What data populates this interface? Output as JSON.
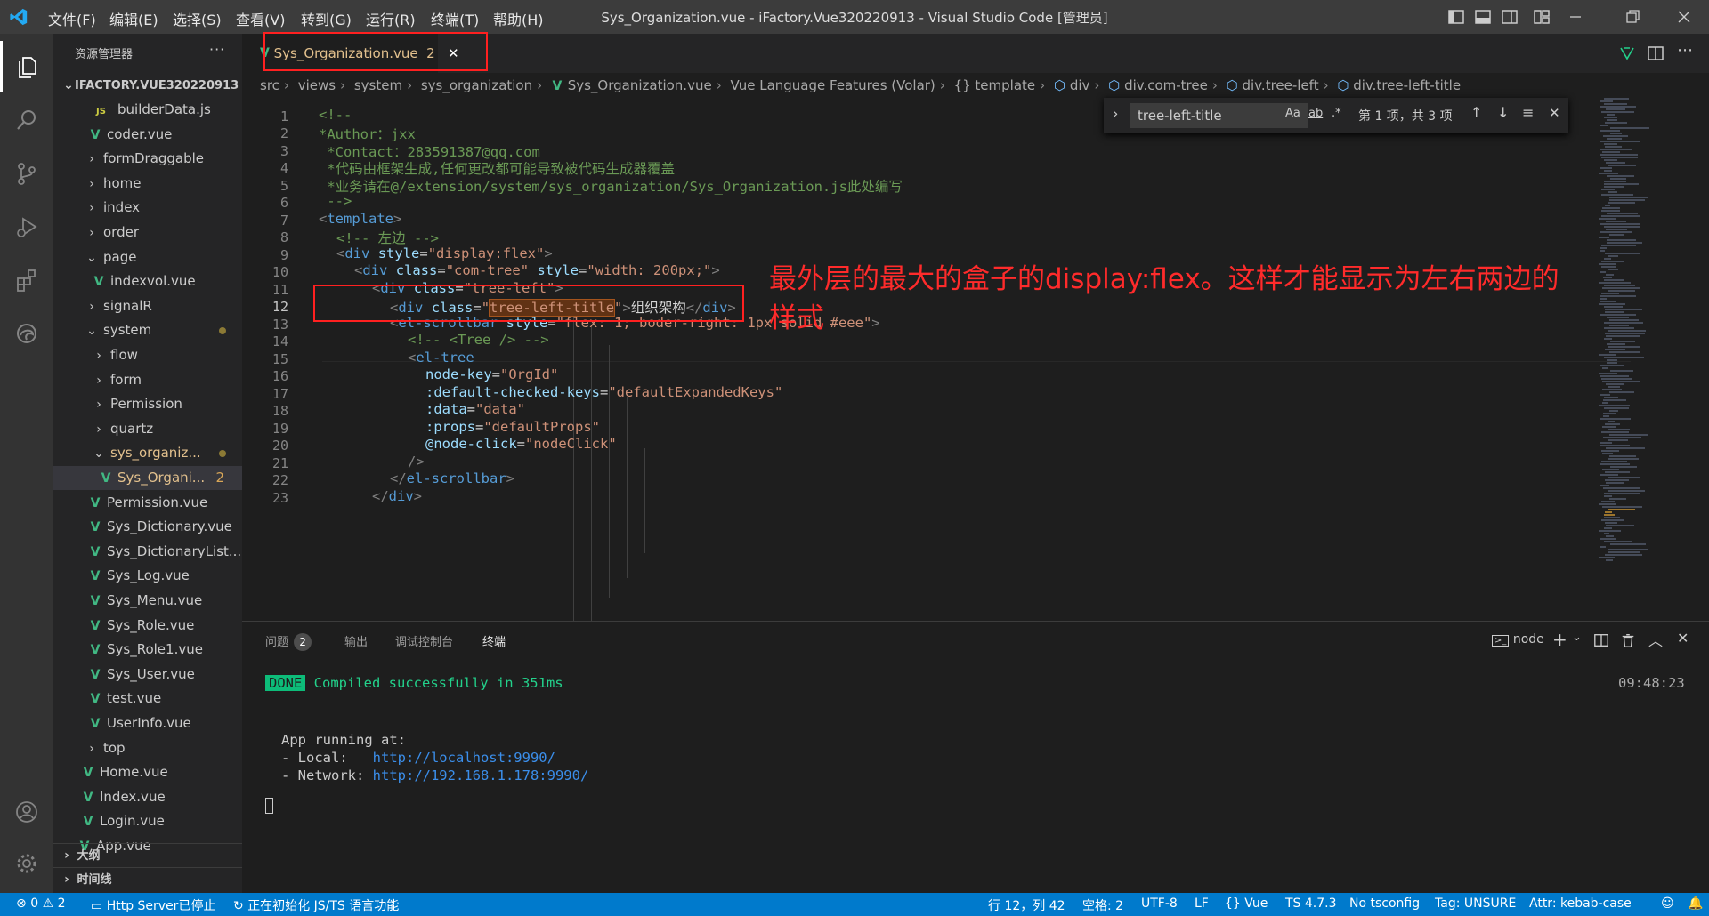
{
  "window": {
    "title": "Sys_Organization.vue - iFactory.Vue320220913 - Visual Studio Code [管理员]",
    "menu": [
      "文件(F)",
      "编辑(E)",
      "选择(S)",
      "查看(V)",
      "转到(G)",
      "运行(R)",
      "终端(T)",
      "帮助(H)"
    ]
  },
  "sidebar": {
    "header": "资源管理器",
    "more": "···",
    "root": "IFACTORY.VUE320220913",
    "rows": [
      {
        "label": "builderData.js",
        "type": "js"
      },
      {
        "label": "coder.vue",
        "type": "vue"
      },
      {
        "label": "formDraggable",
        "type": "folder"
      },
      {
        "label": "home",
        "type": "folder"
      },
      {
        "label": "index",
        "type": "folder"
      },
      {
        "label": "order",
        "type": "folder"
      },
      {
        "label": "page",
        "type": "folder-open"
      },
      {
        "label": "indexvol.vue",
        "type": "vue"
      },
      {
        "label": "signalR",
        "type": "folder"
      },
      {
        "label": "system",
        "type": "folder-open"
      },
      {
        "label": "flow",
        "type": "folder"
      },
      {
        "label": "form",
        "type": "folder"
      },
      {
        "label": "Permission",
        "type": "folder"
      },
      {
        "label": "quartz",
        "type": "folder"
      },
      {
        "label": "sys_organiz...",
        "type": "folder-open"
      },
      {
        "label": "Sys_Organi...",
        "type": "vue",
        "badge": "2"
      },
      {
        "label": "Permission.vue",
        "type": "vue"
      },
      {
        "label": "Sys_Dictionary.vue",
        "type": "vue"
      },
      {
        "label": "Sys_DictionaryList...",
        "type": "vue"
      },
      {
        "label": "Sys_Log.vue",
        "type": "vue"
      },
      {
        "label": "Sys_Menu.vue",
        "type": "vue"
      },
      {
        "label": "Sys_Role.vue",
        "type": "vue"
      },
      {
        "label": "Sys_Role1.vue",
        "type": "vue"
      },
      {
        "label": "Sys_User.vue",
        "type": "vue"
      },
      {
        "label": "test.vue",
        "type": "vue"
      },
      {
        "label": "UserInfo.vue",
        "type": "vue"
      },
      {
        "label": "top",
        "type": "folder"
      },
      {
        "label": "Home.vue",
        "type": "vue"
      },
      {
        "label": "Index.vue",
        "type": "vue"
      },
      {
        "label": "Login.vue",
        "type": "vue"
      },
      {
        "label": "App.vue",
        "type": "vue"
      }
    ],
    "outline": "大纲",
    "timeline": "时间线"
  },
  "tab": {
    "label": "Sys_Organization.vue",
    "badge": "2",
    "close": "✕"
  },
  "breadcrumb": [
    "src",
    "views",
    "system",
    "sys_organization",
    "Sys_Organization.vue",
    "Vue Language Features (Volar)",
    "{} template",
    "div",
    "div.com-tree",
    "div.tree-left",
    "div.tree-left-title"
  ],
  "find": {
    "value": "tree-left-title",
    "case": "Aa",
    "word": "ab",
    "regex": ".*",
    "result": "第 1 项，共 3 项"
  },
  "annotation": "最外层的最大的盒子的display:flex。这样才能显示为左右两边的样式",
  "code": {
    "line_numbers": [
      "1",
      "2",
      "3",
      "4",
      "5",
      "6",
      "7",
      "8",
      "9",
      "10",
      "11",
      "12",
      "13",
      "14",
      "15",
      "16",
      "17",
      "18",
      "19",
      "20",
      "21",
      "22",
      "23"
    ],
    "current_line": "12",
    "lines": {
      "l1": "<!--",
      "l2": "*Author：jxx",
      "l3": " *Contact：283591387@qq.com",
      "l4": " *代码由框架生成,任何更改都可能导致被代码生成器覆盖",
      "l5": " *业务请在@/extension/system/sys_organization/Sys_Organization.js此处编写",
      "l6": " -->",
      "l7_tag": "template",
      "l8": "<!-- 左边 -->",
      "l9_attr": "style",
      "l9_val": "\"display:flex\"",
      "l10_class": "\"com-tree\"",
      "l10_style": "\"width: 200px;\"",
      "l11_class": "\"tree-left\"",
      "l12_hl": "tree-left-title",
      "l12_text": "组织架构",
      "l13_tag": "el-scrollbar",
      "l13_style": "\"flex: 1; boder-right: 1px solid #eee\"",
      "l14": "<!-- <Tree /> -->",
      "l15_tag": "el-tree",
      "l16_attr": "node-key",
      "l16_val": "\"OrgId\"",
      "l17_attr": ":default-checked-keys",
      "l17_val": "\"defaultExpandedKeys\"",
      "l18_attr": ":data",
      "l18_val": "\"data\"",
      "l19_attr": ":props",
      "l19_val": "\"defaultProps\"",
      "l20_attr": "@node-click",
      "l20_val": "\"nodeClick\"",
      "l21": "/>",
      "l22_tag": "el-scrollbar",
      "l23_tag": "div"
    }
  },
  "panel": {
    "tabs": [
      "问题",
      "输出",
      "调试控制台",
      "终端"
    ],
    "problems_count": "2",
    "terminal_name": "node",
    "done": "DONE",
    "compiled": "Compiled successfully in 351ms",
    "time": "09:48:23",
    "app_running": "App running at:",
    "local_label": "- Local:   ",
    "local_url": "http://localhost:9990/",
    "network_label": "- Network: ",
    "network_url": "http://192.168.1.178:9990/"
  },
  "status": {
    "errors": "0",
    "warnings": "2",
    "http": "Http Server已停止",
    "init": "正在初始化 JS/TS 语言功能",
    "position": "行 12，列 42",
    "spaces": "空格: 2",
    "encoding": "UTF-8",
    "eol": "LF",
    "lang": "Vue",
    "ts": "TS 4.7.3",
    "tsconfig": "No tsconfig",
    "tag": "Tag: UNSURE",
    "attr": "Attr: kebab-case"
  },
  "colors": {
    "accent": "#007acc",
    "annotation": "#ff2b2b",
    "vue": "#41b883"
  }
}
